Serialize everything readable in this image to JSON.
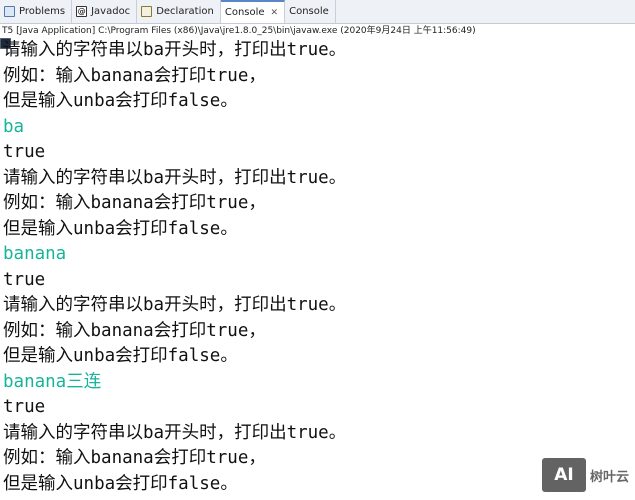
{
  "tabs": [
    {
      "label": "Problems",
      "icon": "problems-icon"
    },
    {
      "label": "Javadoc",
      "icon": "javadoc-icon"
    },
    {
      "label": "Declaration",
      "icon": "declaration-icon"
    },
    {
      "label": "Console",
      "icon": "console-icon",
      "active": true,
      "close": "✕"
    },
    {
      "label": "Console",
      "icon": "console-icon"
    }
  ],
  "status": "T5 [Java Application] C:\\Program Files (x86)\\Java\\jre1.8.0_25\\bin\\javaw.exe (2020年9月24日 上午11:56:49)",
  "console": {
    "lines": [
      {
        "text": "请输入的字符串以ba开头时，打印出true。",
        "type": "output"
      },
      {
        "text": "例如：输入banana会打印true，",
        "type": "output"
      },
      {
        "text": "但是输入unba会打印false。",
        "type": "output"
      },
      {
        "text": "ba",
        "type": "input"
      },
      {
        "text": "true",
        "type": "output"
      },
      {
        "text": "请输入的字符串以ba开头时，打印出true。",
        "type": "output"
      },
      {
        "text": "例如：输入banana会打印true，",
        "type": "output"
      },
      {
        "text": "但是输入unba会打印false。",
        "type": "output"
      },
      {
        "text": "banana",
        "type": "input"
      },
      {
        "text": "true",
        "type": "output"
      },
      {
        "text": "请输入的字符串以ba开头时，打印出true。",
        "type": "output"
      },
      {
        "text": "例如：输入banana会打印true，",
        "type": "output"
      },
      {
        "text": "但是输入unba会打印false。",
        "type": "output"
      },
      {
        "text": "banana三连",
        "type": "input"
      },
      {
        "text": "true",
        "type": "output"
      },
      {
        "text": "请输入的字符串以ba开头时，打印出true。",
        "type": "output"
      },
      {
        "text": "例如：输入banana会打印true，",
        "type": "output"
      },
      {
        "text": "但是输入unba会打印false。",
        "type": "output"
      }
    ]
  },
  "watermark": {
    "logo": "AI",
    "text": "树叶云"
  },
  "colors": {
    "input_text": "#17b39a",
    "output_text": "#111111",
    "tab_accent": "#5b86c7"
  }
}
